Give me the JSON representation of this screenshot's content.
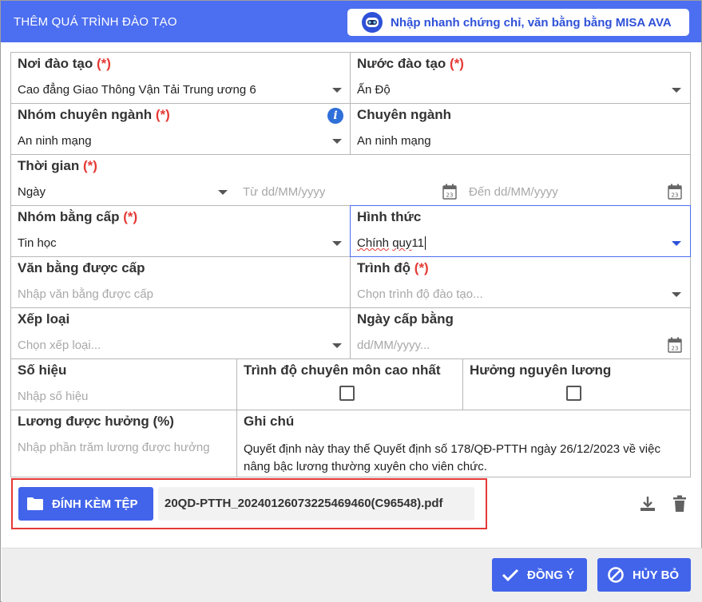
{
  "dialog": {
    "title": "THÊM QUÁ TRÌNH ĐÀO TẠO",
    "ava_button": "Nhập nhanh chứng chỉ, văn bằng bằng MISA AVA"
  },
  "form": {
    "noi_dao_tao": {
      "label": "Nơi đào tạo",
      "required": "(*)",
      "value": "Cao đẳng Giao Thông Vận Tải Trung ương 6"
    },
    "nuoc_dao_tao": {
      "label": "Nước đào tạo",
      "required": "(*)",
      "value": "Ấn Độ"
    },
    "nhom_chuyen_nganh": {
      "label": "Nhóm chuyên ngành",
      "required": "(*)",
      "value": "An ninh mạng"
    },
    "chuyen_nganh": {
      "label": "Chuyên ngành",
      "value": "An ninh mạng"
    },
    "thoi_gian": {
      "label": "Thời gian",
      "required": "(*)",
      "unit": "Ngày",
      "from_placeholder": "Từ dd/MM/yyyy",
      "to_placeholder": "Đến dd/MM/yyyy"
    },
    "nhom_bang_cap": {
      "label": "Nhóm bằng cấp",
      "required": "(*)",
      "value": "Tin học"
    },
    "hinh_thuc": {
      "label": "Hình thức",
      "value_word1": "Chính",
      "value_word2": "quy",
      "value_suffix": "11"
    },
    "van_bang": {
      "label": "Văn bằng được cấp",
      "placeholder": "Nhập văn bằng được cấp"
    },
    "trinh_do": {
      "label": "Trình độ",
      "required": "(*)",
      "placeholder": "Chọn trình độ đào tạo..."
    },
    "xep_loai": {
      "label": "Xếp loại",
      "placeholder": "Chọn xếp loại..."
    },
    "ngay_cap_bang": {
      "label": "Ngày cấp bằng",
      "placeholder": "dd/MM/yyyy..."
    },
    "so_hieu": {
      "label": "Số hiệu",
      "placeholder": "Nhập số hiệu"
    },
    "trinh_do_cao_nhat": {
      "label": "Trình độ chuyên môn cao nhất",
      "checked": false
    },
    "huong_nguyen_luong": {
      "label": "Hưởng nguyên lương",
      "checked": false
    },
    "luong_duoc_huong": {
      "label": "Lương được hưởng (%)",
      "placeholder": "Nhập phần trăm lương được hưởng"
    },
    "ghi_chu": {
      "label": "Ghi chú",
      "value": "Quyết định này thay thế Quyết định số 178/QĐ-PTTH ngày 26/12/2023 về việc nâng bậc lương thường xuyên cho viên chức."
    }
  },
  "attachment": {
    "button": "ĐÍNH KÈM TỆP",
    "file_name": "20QD-PTTH_20240126073225469460(C96548).pdf"
  },
  "footer": {
    "ok": "ĐỒNG Ý",
    "cancel": "HỦY BỎ"
  },
  "colors": {
    "primary": "#4264ea",
    "header": "#4c6ef0",
    "required": "#e53935",
    "highlight_border": "#e53935"
  },
  "icons": [
    "robot-icon",
    "info-icon",
    "calendar-icon",
    "folder-icon",
    "download-icon",
    "trash-icon",
    "check-icon",
    "ban-icon",
    "chevron-down-icon"
  ]
}
